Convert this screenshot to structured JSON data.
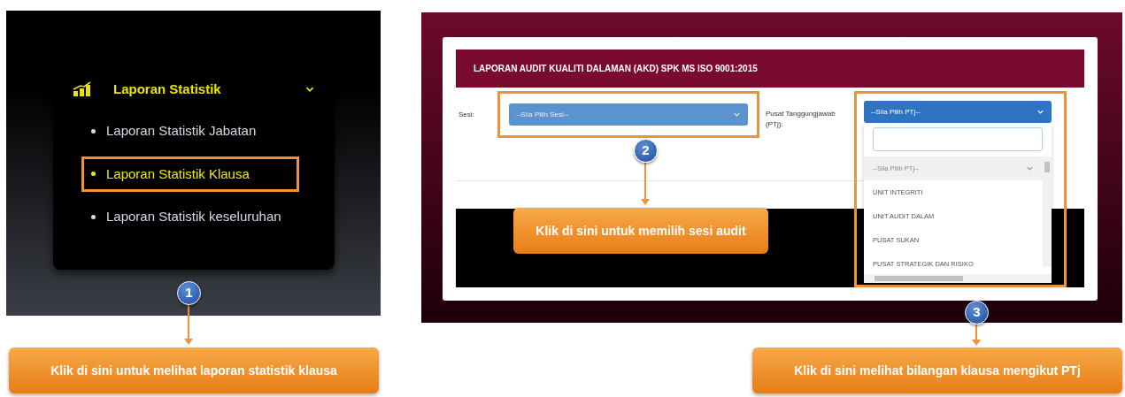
{
  "sidebar": {
    "title": "Laporan Statistik",
    "expanded": true,
    "items": [
      {
        "label": "Laporan Statistik Jabatan",
        "selected": false,
        "highlighted": false
      },
      {
        "label": "Laporan Statistik Klausa",
        "selected": true,
        "highlighted": true
      },
      {
        "label": "Laporan Statistik keseluruhan",
        "selected": false,
        "highlighted": false
      }
    ]
  },
  "report": {
    "title": "LAPORAN AUDIT KUALITI DALAMAN (AKD) SPK MS ISO 9001:2015",
    "session": {
      "label": "Sesi:",
      "placeholder": "--Sila Pilih Sesi--",
      "highlighted": true
    },
    "ptj": {
      "label": "Pusat Tanggungjawab (PTj):",
      "placeholder": "--Sila Pilih PTj--",
      "highlighted": true,
      "expanded": true,
      "options": [
        {
          "label": "--Sila Pilih PTj--",
          "selected": true
        },
        {
          "label": "UNIT INTEGRITI",
          "selected": false
        },
        {
          "label": "UNIT AUDIT DALAM",
          "selected": false
        },
        {
          "label": "PUSAT SUKAN",
          "selected": false
        },
        {
          "label": "PUSAT STRATEGIK DAN RISIKO",
          "selected": false
        }
      ]
    }
  },
  "callouts": [
    {
      "number": "1",
      "text": "Klik di sini untuk melihat laporan statistik klausa"
    },
    {
      "number": "2",
      "text": "Klik di sini untuk memilih sesi audit"
    },
    {
      "number": "3",
      "text": "Klik di sini melihat bilangan klausa mengikut PTj"
    }
  ]
}
